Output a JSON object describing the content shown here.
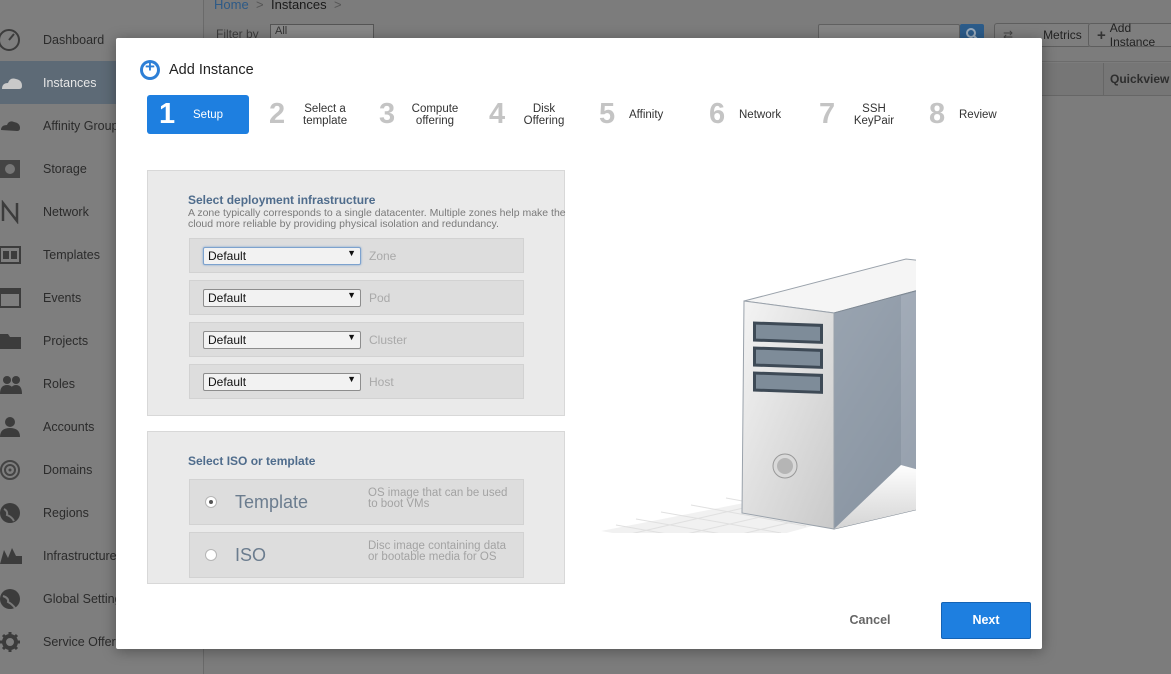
{
  "background": {
    "breadcrumb": {
      "home": "Home",
      "separator": ">",
      "current": "Instances"
    },
    "filter": {
      "label": "Filter by",
      "value": "All"
    },
    "buttons": {
      "metrics": "Metrics",
      "add_instance": "Add Instance"
    },
    "table": {
      "quickview_header": "Quickview"
    },
    "sidebar": {
      "items": [
        {
          "label": "Dashboard",
          "icon": "dashboard-icon"
        },
        {
          "label": "Instances",
          "icon": "cloud-icon",
          "active": true
        },
        {
          "label": "Affinity Groups",
          "icon": "affinity-icon"
        },
        {
          "label": "Storage",
          "icon": "storage-icon"
        },
        {
          "label": "Network",
          "icon": "network-icon"
        },
        {
          "label": "Templates",
          "icon": "templates-icon"
        },
        {
          "label": "Events",
          "icon": "calendar-icon"
        },
        {
          "label": "Projects",
          "icon": "folder-icon"
        },
        {
          "label": "Roles",
          "icon": "roles-icon"
        },
        {
          "label": "Accounts",
          "icon": "user-icon"
        },
        {
          "label": "Domains",
          "icon": "domains-icon"
        },
        {
          "label": "Regions",
          "icon": "globe-icon"
        },
        {
          "label": "Infrastructure",
          "icon": "infrastructure-icon"
        },
        {
          "label": "Global Settings",
          "icon": "settings-globe-icon"
        },
        {
          "label": "Service Offerings",
          "icon": "gear-icon"
        }
      ]
    }
  },
  "modal": {
    "title": "Add Instance",
    "steps": [
      {
        "number": "1",
        "label": "Setup",
        "active": true
      },
      {
        "number": "2",
        "label": "Select a template"
      },
      {
        "number": "3",
        "label": "Compute offering"
      },
      {
        "number": "4",
        "label": "Disk Offering"
      },
      {
        "number": "5",
        "label": "Affinity"
      },
      {
        "number": "6",
        "label": "Network"
      },
      {
        "number": "7",
        "label": "SSH KeyPair"
      },
      {
        "number": "8",
        "label": "Review"
      }
    ],
    "deployment": {
      "heading": "Select deployment infrastructure",
      "description": "A zone typically corresponds to a single datacenter. Multiple zones help make the cloud more reliable by providing physical isolation and redundancy.",
      "fields": [
        {
          "value": "Default",
          "label": "Zone"
        },
        {
          "value": "Default",
          "label": "Pod"
        },
        {
          "value": "Default",
          "label": "Cluster"
        },
        {
          "value": "Default",
          "label": "Host"
        }
      ]
    },
    "iso_template": {
      "heading": "Select ISO or template",
      "options": [
        {
          "name": "Template",
          "description": "OS image that can be used to boot VMs",
          "selected": true
        },
        {
          "name": "ISO",
          "description": "Disc image containing data or bootable media for OS",
          "selected": false
        }
      ]
    },
    "actions": {
      "cancel": "Cancel",
      "next": "Next"
    },
    "colors": {
      "accent": "#1e7fe0",
      "heading": "#4f6c8c"
    }
  }
}
